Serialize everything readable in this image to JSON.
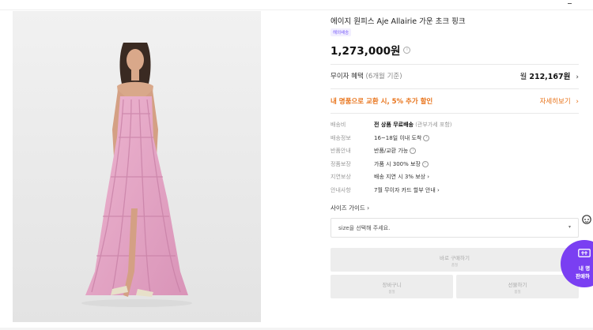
{
  "product": {
    "name": "에이지 원피스 Aje Allairie 가운 초크 핑크",
    "badge": "해외배송",
    "price": "1,273,000원",
    "price_info": "i"
  },
  "benefit": {
    "label": "무이자 혜택",
    "period": "(6개월 기준)",
    "monthly_prefix": "월",
    "monthly_amount": "212,167원",
    "chevron": "›"
  },
  "exchange": {
    "label": "내 명품으로 교환 시, 5% 추가 할인",
    "link": "자세히보기",
    "chevron": "›"
  },
  "specs": [
    {
      "label": "배송비",
      "value": "전 상품 무료배송",
      "note": "(관부가세 포함)"
    },
    {
      "label": "배송정보",
      "value": "16~18일 이내 도착",
      "icon": "i"
    },
    {
      "label": "반품안내",
      "value": "반품/교환 가능",
      "icon": "i"
    },
    {
      "label": "정품보장",
      "value": "가품 시 300% 보장",
      "icon": "i"
    },
    {
      "label": "지연보상",
      "value": "배송 지연 시 3% 보상 ›"
    },
    {
      "label": "안내사항",
      "value": "7월 무이자 카드 할부 안내 ›"
    }
  ],
  "size_guide": "사이즈 가이드 ›",
  "size_select": {
    "placeholder": "size을 선택해 주세요.",
    "caret": "▾"
  },
  "buttons": {
    "buy": {
      "label": "바로 구매하기",
      "sub": "품절"
    },
    "cart": {
      "label": "장바구니",
      "sub": "품절"
    },
    "gift": {
      "label": "선물하기",
      "sub": "품절"
    }
  },
  "fab": {
    "line1": "내 명",
    "line2": "판매하"
  },
  "colors": {
    "accent": "#7a3ff2",
    "orange": "#e8731a",
    "dress": "#e8a8c8"
  }
}
